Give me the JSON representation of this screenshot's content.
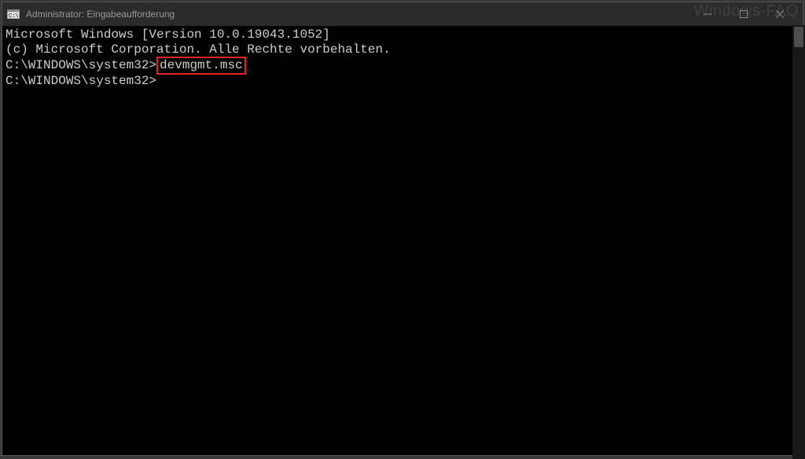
{
  "window": {
    "title": "Administrator: Eingabeaufforderung"
  },
  "terminal": {
    "line1": "Microsoft Windows [Version 10.0.19043.1052]",
    "line2": "(c) Microsoft Corporation. Alle Rechte vorbehalten.",
    "blank1": "",
    "prompt1_prefix": "C:\\WINDOWS\\system32>",
    "command": "devmgmt.msc",
    "blank2": "",
    "prompt2": "C:\\WINDOWS\\system32>"
  },
  "watermark": "Windows-FAQ"
}
